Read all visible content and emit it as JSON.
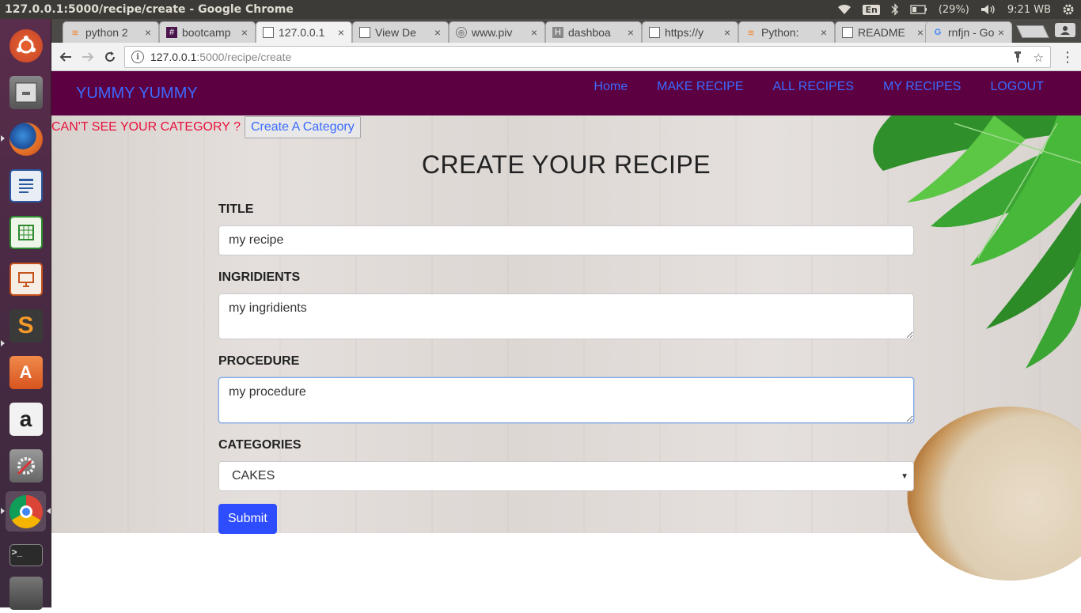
{
  "os": {
    "window_title": "127.0.0.1:5000/recipe/create - Google Chrome",
    "language": "En",
    "battery": "(29%)",
    "clock": "9:21 WB"
  },
  "browser": {
    "tabs": [
      {
        "label": "python 2",
        "icon": "stackoverflow-icon"
      },
      {
        "label": "bootcamp",
        "icon": "slack-icon"
      },
      {
        "label": "127.0.0.1",
        "icon": "page-icon"
      },
      {
        "label": "View De",
        "icon": "page-icon"
      },
      {
        "label": "www.piv",
        "icon": "globe-icon"
      },
      {
        "label": "dashboa",
        "icon": "heroku-icon"
      },
      {
        "label": "https://y",
        "icon": "page-icon"
      },
      {
        "label": "Python:",
        "icon": "stackoverflow-icon"
      },
      {
        "label": "README",
        "icon": "page-icon"
      },
      {
        "label": "rnfjn - Go",
        "icon": "google-icon"
      }
    ],
    "active_tab_index": 2,
    "url_host": "127.0.0.1",
    "url_path": ":5000/recipe/create"
  },
  "app": {
    "brand": "YUMMY YUMMY",
    "nav": {
      "home": "Home",
      "make_recipe": "MAKE RECIPE",
      "all_recipes": "ALL RECIPES",
      "my_recipes": "MY RECIPES",
      "logout": "LOGOUT"
    },
    "category_help": "CAN'T SEE YOUR CATEGORY ?",
    "create_category_button": "Create A Category",
    "form_title": "CREATE YOUR RECIPE",
    "title_label": "TITLE",
    "title_value": "my recipe",
    "ingredients_label": "INGRIDIENTS",
    "ingredients_value": "my ingridients",
    "procedure_label": "PROCEDURE",
    "procedure_value": "my procedure",
    "categories_label": "CATEGORIES",
    "category_selected": "CAKES",
    "submit_label": "Submit"
  },
  "colors": {
    "navbar": "#5d0041",
    "link": "#3b6bff",
    "warning": "#e8103a",
    "submit": "#2e4dff"
  }
}
